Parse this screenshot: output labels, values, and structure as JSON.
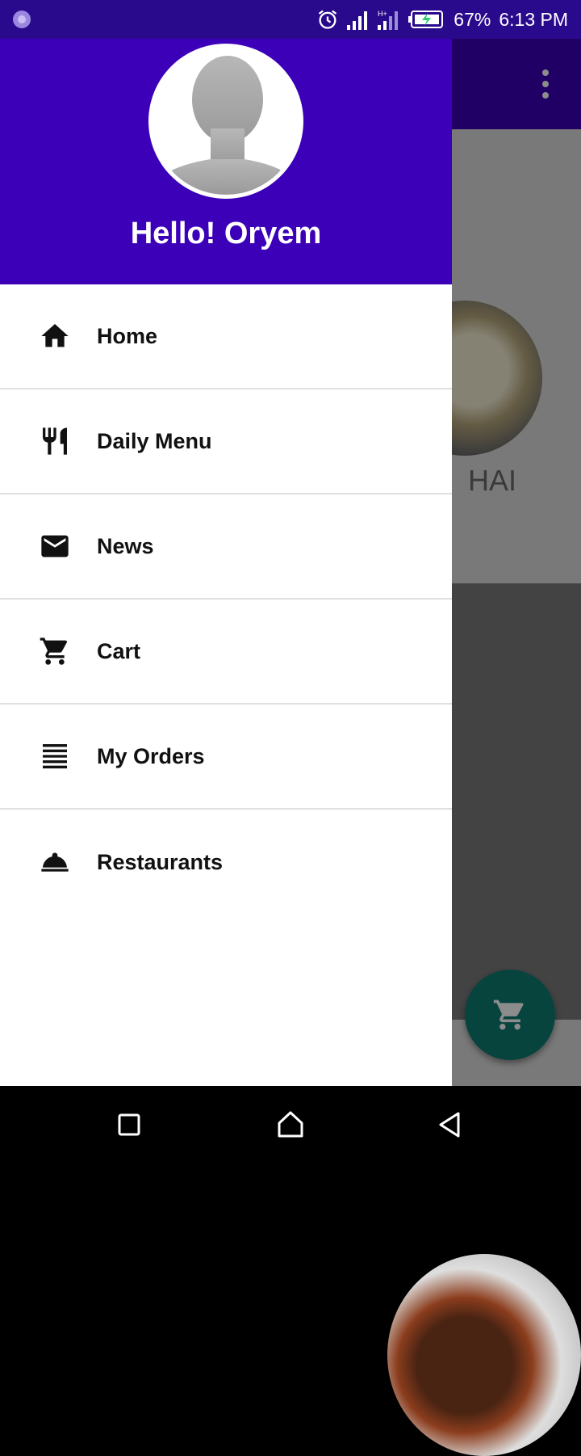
{
  "status_bar": {
    "battery": "67%",
    "time": "6:13 PM",
    "icons": [
      "app-notification-icon",
      "alarm-icon",
      "signal-icon",
      "signal-4g-icon",
      "battery-charging-icon"
    ]
  },
  "background_app": {
    "card_title": "HAI",
    "menu_icon": "more-vert-icon",
    "fab_icon": "cart-icon",
    "colors": {
      "toolbar": "#3c00b9",
      "fab": "#0e7c72"
    }
  },
  "drawer": {
    "greeting": "Hello! Oryem",
    "header_color": "#3c00b9",
    "items": [
      {
        "label": "Home",
        "icon": "home-icon"
      },
      {
        "label": "Daily Menu",
        "icon": "restaurant-icon"
      },
      {
        "label": "News",
        "icon": "mail-icon"
      },
      {
        "label": "Cart",
        "icon": "cart-icon"
      },
      {
        "label": "My Orders",
        "icon": "list-icon"
      },
      {
        "label": "Restaurants",
        "icon": "room-service-icon"
      }
    ]
  },
  "nav_bar": {
    "buttons": [
      "recents-button",
      "home-button",
      "back-button"
    ]
  }
}
